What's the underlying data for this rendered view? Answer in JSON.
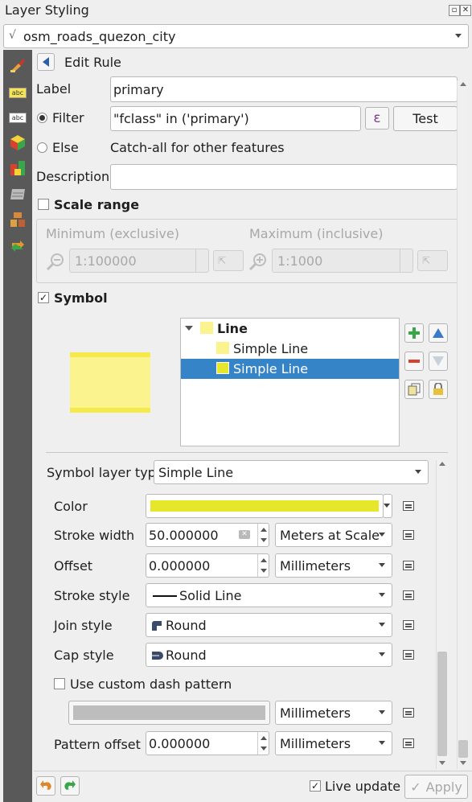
{
  "panel": {
    "title": "Layer Styling"
  },
  "layer_selector": {
    "value": "osm_roads_quezon_city"
  },
  "rule": {
    "header": "Edit Rule",
    "label_caption": "Label",
    "label_value": "primary",
    "filter_caption": "Filter",
    "filter_value": "\"fclass\" in ('primary')",
    "expression_glyph": "ε",
    "test_label": "Test",
    "else_caption": "Else",
    "else_text": "Catch-all for other features",
    "description_caption": "Description",
    "description_value": ""
  },
  "scale_range": {
    "label": "Scale range",
    "min_caption": "Minimum (exclusive)",
    "max_caption": "Maximum (inclusive)",
    "min_value": "1:100000",
    "max_value": "1:1000"
  },
  "symbol": {
    "label": "Symbol",
    "preview_color": "#fbf38e",
    "tree": [
      {
        "label": "Line",
        "swatch": "#fbf38e"
      },
      {
        "label": "Simple Line",
        "swatch": "#fbf38e"
      },
      {
        "label": "Simple Line",
        "swatch": "#e6e62a"
      }
    ]
  },
  "props": {
    "layer_type_caption": "Symbol layer type",
    "layer_type_value": "Simple Line",
    "color_caption": "Color",
    "color_value": "#e6e62a",
    "stroke_width_caption": "Stroke width",
    "stroke_width_value": "50.000000",
    "stroke_width_unit": "Meters at Scale",
    "offset_caption": "Offset",
    "offset_value": "0.000000",
    "offset_unit": "Millimeters",
    "stroke_style_caption": "Stroke style",
    "stroke_style_value": "Solid Line",
    "join_style_caption": "Join style",
    "join_style_value": "Round",
    "cap_style_caption": "Cap style",
    "cap_style_value": "Round",
    "dash_caption": "Use custom dash pattern",
    "dash_unit": "Millimeters",
    "pattern_offset_caption": "Pattern offset",
    "pattern_offset_value": "0.000000",
    "pattern_offset_unit": "Millimeters"
  },
  "footer": {
    "live_update_label": "Live update",
    "apply_label": "Apply"
  }
}
